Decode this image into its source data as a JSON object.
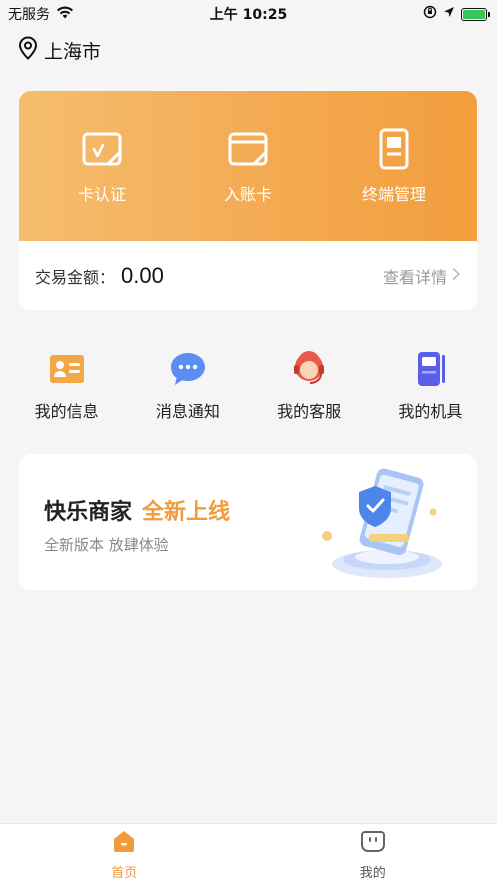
{
  "status_bar": {
    "carrier": "无服务",
    "time": "上午 10:25"
  },
  "location": {
    "city": "上海市"
  },
  "card": {
    "actions": [
      {
        "label": "卡认证",
        "icon": "card-verify-icon"
      },
      {
        "label": "入账卡",
        "icon": "deposit-card-icon"
      },
      {
        "label": "终端管理",
        "icon": "terminal-icon"
      }
    ],
    "amount_label": "交易金额：",
    "amount_value": "0.00",
    "detail_link": "查看详情"
  },
  "quick_menu": [
    {
      "label": "我的信息",
      "icon": "id-card-icon"
    },
    {
      "label": "消息通知",
      "icon": "chat-bubble-icon"
    },
    {
      "label": "我的客服",
      "icon": "customer-service-icon"
    },
    {
      "label": "我的机具",
      "icon": "pos-machine-icon"
    }
  ],
  "promo": {
    "title": "快乐商家",
    "title_accent": "全新上线",
    "subtitle": "全新版本 放肆体验"
  },
  "tab_bar": [
    {
      "label": "首页",
      "icon": "home-icon",
      "active": true
    },
    {
      "label": "我的",
      "icon": "profile-icon",
      "active": false
    }
  ],
  "colors": {
    "accent": "#f29b3a",
    "card_gradient_start": "#f5bd6e",
    "card_gradient_end": "#f29e3d"
  }
}
